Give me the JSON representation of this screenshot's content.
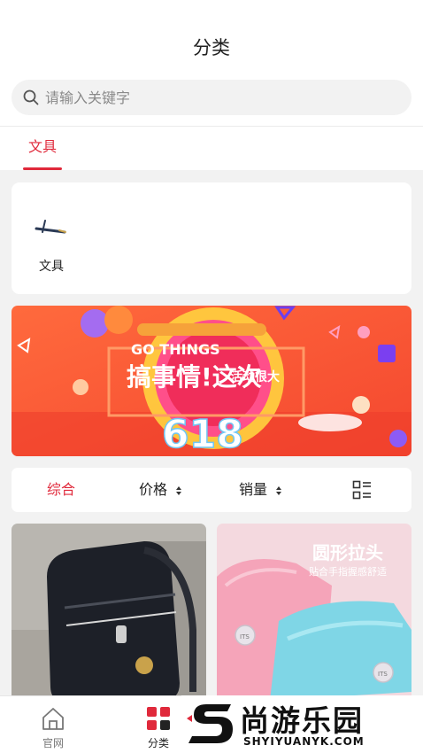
{
  "header": {
    "title": "分类"
  },
  "search": {
    "placeholder": "请输入关键字",
    "value": "",
    "icon": "search-icon"
  },
  "category_tabs": [
    {
      "label": "文具",
      "active": true
    }
  ],
  "categories": [
    {
      "label": "文具",
      "icon": "fountain-pen-icon"
    }
  ],
  "banner": {
    "line1": "GO THINGS",
    "line2": "搞事情!这次",
    "line3": "活动很大",
    "number": "618"
  },
  "sort": {
    "items": [
      {
        "label": "综合",
        "active": true
      },
      {
        "label": "价格",
        "sortable": true
      },
      {
        "label": "销量",
        "sortable": true
      }
    ],
    "layout_toggle_icon": "list-layout-icon"
  },
  "products": [
    {
      "image": "black-school-backpack"
    },
    {
      "image": "pink-blue-pencil-cases",
      "caption_title": "圆形拉头",
      "caption_sub": "贴合手指握感舒适",
      "tag": "ITS"
    }
  ],
  "tab_bar": [
    {
      "label": "官网",
      "icon": "home-icon",
      "active": false
    },
    {
      "label": "分类",
      "icon": "category-grid-icon",
      "active": true
    }
  ],
  "watermark": {
    "title": "尚游乐园",
    "sub": "SHYIYUANYK.COM"
  },
  "colors": {
    "accent": "#e0293b",
    "background": "#f2f2f2"
  }
}
